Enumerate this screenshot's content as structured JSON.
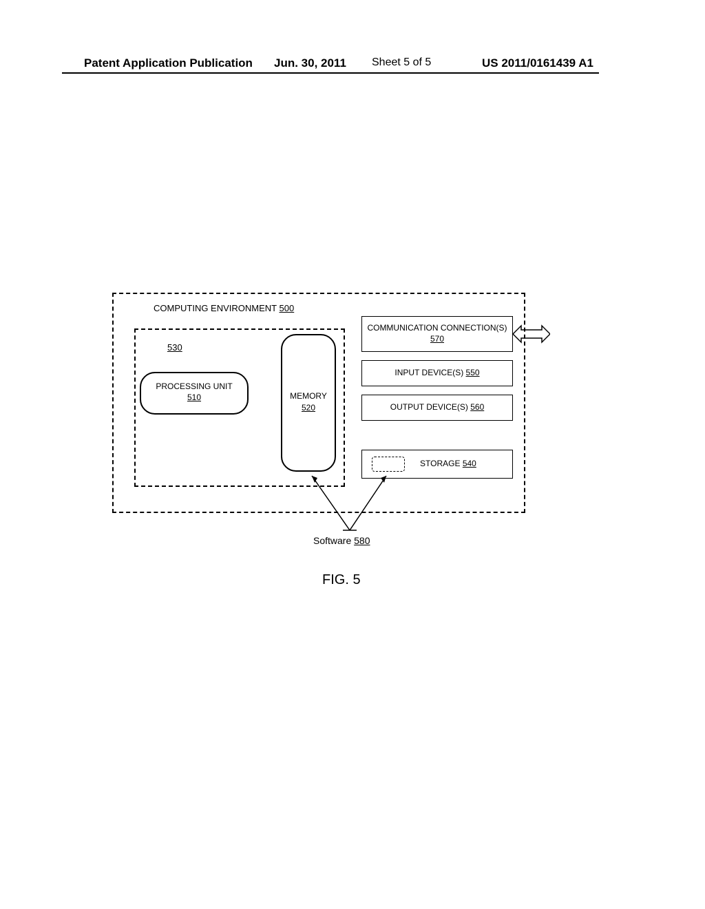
{
  "header": {
    "left": "Patent Application Publication",
    "date": "Jun. 30, 2011",
    "sheet": "Sheet 5 of 5",
    "pubnum": "US 2011/0161439 A1"
  },
  "diagram": {
    "env_title": "COMPUTING ENVIRONMENT",
    "env_num": "500",
    "inner_num": "530",
    "proc_unit_label": "PROCESSING UNIT",
    "proc_unit_num": "510",
    "memory_label": "MEMORY",
    "memory_num": "520",
    "comm_label": "COMMUNICATION CONNECTION(S)",
    "comm_num": "570",
    "input_label": "INPUT DEVICE(S)",
    "input_num": "550",
    "output_label": "OUTPUT DEVICE(S)",
    "output_num": "560",
    "storage_label": "STORAGE",
    "storage_num": "540",
    "software_label": "Software",
    "software_num": "580"
  },
  "figure_label": "FIG. 5"
}
